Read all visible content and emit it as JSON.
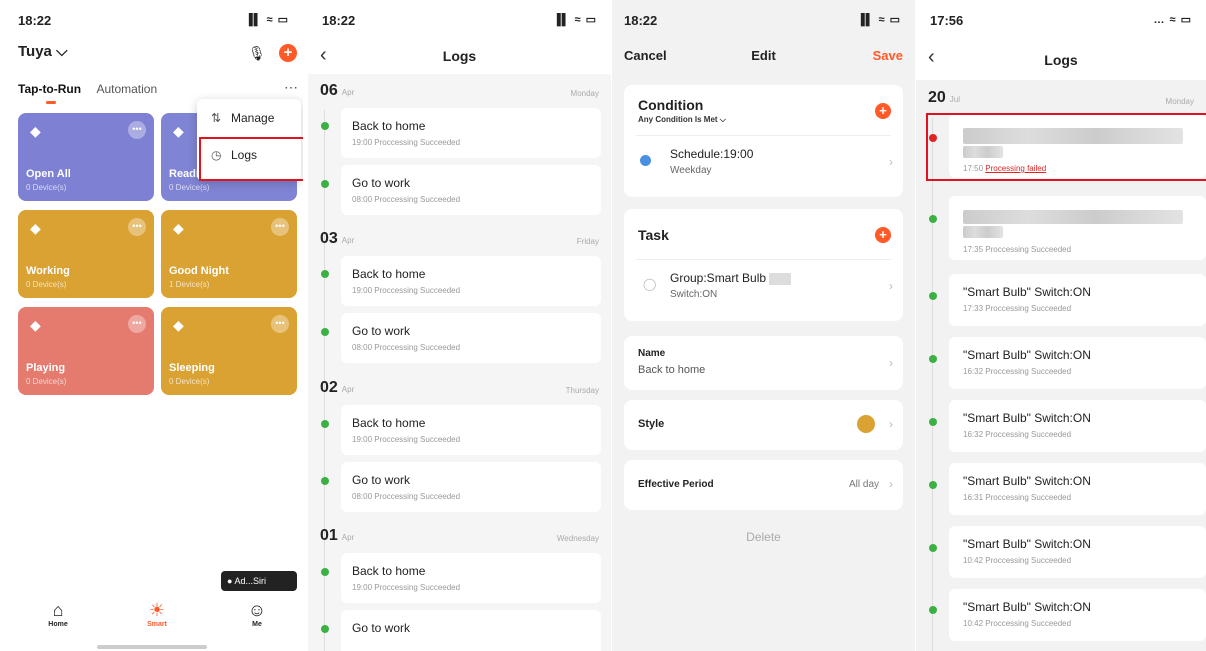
{
  "panel1": {
    "status": {
      "time": "18:22",
      "icons": "▐▌ ≈ ▭"
    },
    "home_title": "Tuya ⌵",
    "tabs": [
      "Tap-to-Run",
      "Automation"
    ],
    "menu": {
      "manage": "Manage",
      "logs": "Logs"
    },
    "cards": [
      {
        "name": "Open All",
        "devices": "0 Device(s)",
        "color": "#7d80d3"
      },
      {
        "name": "Reading",
        "devices": "0 Device(s)",
        "color": "#8084d4"
      },
      {
        "name": "Working",
        "devices": "0 Device(s)",
        "color": "#d9a233"
      },
      {
        "name": "Good Night",
        "devices": "1 Device(s)",
        "color": "#d9a233"
      },
      {
        "name": "Playing",
        "devices": "0 Device(s)",
        "color": "#e57a6e"
      },
      {
        "name": "Sleeping",
        "devices": "0 Device(s)",
        "color": "#d9a233"
      }
    ],
    "siri": "Ad...Siri",
    "nav": {
      "home": "Home",
      "smart": "Smart",
      "me": "Me"
    },
    "accent": "#ff5a27"
  },
  "panel2": {
    "status": {
      "time": "18:22"
    },
    "title": "Logs",
    "days": [
      {
        "day": "06",
        "month": "Apr",
        "weekday": "Monday",
        "entries": [
          {
            "name": "Back to home",
            "detail": "19:00 Proccessing Succeeded"
          },
          {
            "name": "Go to work",
            "detail": "08:00 Proccessing Succeeded"
          }
        ]
      },
      {
        "day": "03",
        "month": "Apr",
        "weekday": "Friday",
        "entries": [
          {
            "name": "Back to home",
            "detail": "19:00 Proccessing Succeeded"
          },
          {
            "name": "Go to work",
            "detail": "08:00 Proccessing Succeeded"
          }
        ]
      },
      {
        "day": "02",
        "month": "Apr",
        "weekday": "Thursday",
        "entries": [
          {
            "name": "Back to home",
            "detail": "19:00 Proccessing Succeeded"
          },
          {
            "name": "Go to work",
            "detail": "08:00 Proccessing Succeeded"
          }
        ]
      },
      {
        "day": "01",
        "month": "Apr",
        "weekday": "Wednesday",
        "entries": [
          {
            "name": "Back to home",
            "detail": "19:00 Proccessing Succeeded"
          },
          {
            "name": "Go to work",
            "detail": ""
          }
        ]
      }
    ]
  },
  "panel3": {
    "status": {
      "time": "18:22"
    },
    "cancel": "Cancel",
    "title": "Edit",
    "save": "Save",
    "condition": {
      "title": "Condition",
      "subtitle": "Any Condition Is Met ⌵",
      "item_title": "Schedule:19:00",
      "item_sub": "Weekday"
    },
    "task": {
      "title": "Task",
      "item_title": "Group:Smart Bulb",
      "item_sub": "Switch:ON"
    },
    "name": {
      "label": "Name",
      "value": "Back to home"
    },
    "style": {
      "label": "Style",
      "color": "#d9a233"
    },
    "period": {
      "label": "Effective Period",
      "value": "All day"
    },
    "delete": "Delete"
  },
  "panel4": {
    "status": {
      "time": "17:56"
    },
    "title": "Logs",
    "day": "20",
    "month": "Jul",
    "weekday": "Monday",
    "entries": [
      {
        "time": "17:50",
        "status": "Processing failed"
      },
      {
        "detail": "17:35 Proccessing Succeeded"
      },
      {
        "name": "\"Smart Bulb\" Switch:ON",
        "detail": "17:33 Proccessing Succeeded"
      },
      {
        "name": "\"Smart Bulb\" Switch:ON",
        "detail": "16:32 Proccessing Succeeded"
      },
      {
        "name": "\"Smart Bulb\" Switch:ON",
        "detail": "16:32 Proccessing Succeeded"
      },
      {
        "name": "\"Smart Bulb\" Switch:ON",
        "detail": "16:31 Proccessing Succeeded"
      },
      {
        "name": "\"Smart Bulb\" Switch:ON",
        "detail": "10:42 Proccessing Succeeded"
      },
      {
        "name": "\"Smart Bulb\" Switch:ON",
        "detail": "10:42 Proccessing Succeeded"
      }
    ]
  }
}
